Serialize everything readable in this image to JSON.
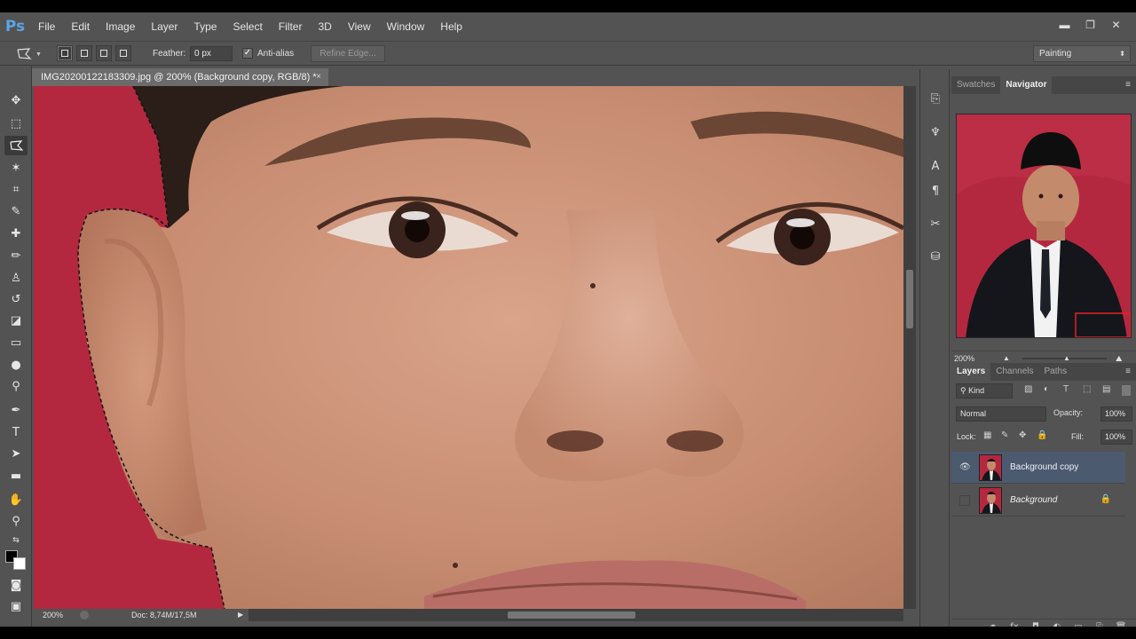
{
  "app": {
    "logo": "Ps"
  },
  "menu": [
    "File",
    "Edit",
    "Image",
    "Layer",
    "Type",
    "Select",
    "Filter",
    "3D",
    "View",
    "Window",
    "Help"
  ],
  "window_controls": {
    "minimize": "▬",
    "restore": "❐",
    "close": "✕"
  },
  "options": {
    "feather_label": "Feather:",
    "feather_value": "0 px",
    "antialias_label": "Anti-alias",
    "antialias_checked": true,
    "refine_edge": "Refine Edge...",
    "workspace": "Painting"
  },
  "document": {
    "tab_title": "IMG20200122183309.jpg @ 200% (Background copy, RGB/8) *",
    "close": "×",
    "zoom": "200%",
    "doc_info": "Doc: 8,74M/17,5M"
  },
  "navigator": {
    "tabs": [
      "Swatches",
      "Navigator"
    ],
    "active_tab": "Navigator",
    "zoom": "200%"
  },
  "layers": {
    "tabs": [
      "Layers",
      "Channels",
      "Paths"
    ],
    "active_tab": "Layers",
    "filter_kind": "Kind",
    "blend_mode": "Normal",
    "opacity_label": "Opacity:",
    "opacity_value": "100%",
    "lock_label": "Lock:",
    "fill_label": "Fill:",
    "fill_value": "100%",
    "items": [
      {
        "name": "Background copy",
        "visible": true,
        "selected": true,
        "locked": false
      },
      {
        "name": "Background",
        "visible": false,
        "selected": false,
        "locked": true
      }
    ]
  },
  "colors": {
    "background_red": "#b4283f",
    "skin": "#ca8f74",
    "ui_dark": "#535353",
    "selected_layer": "#4c5a70"
  }
}
